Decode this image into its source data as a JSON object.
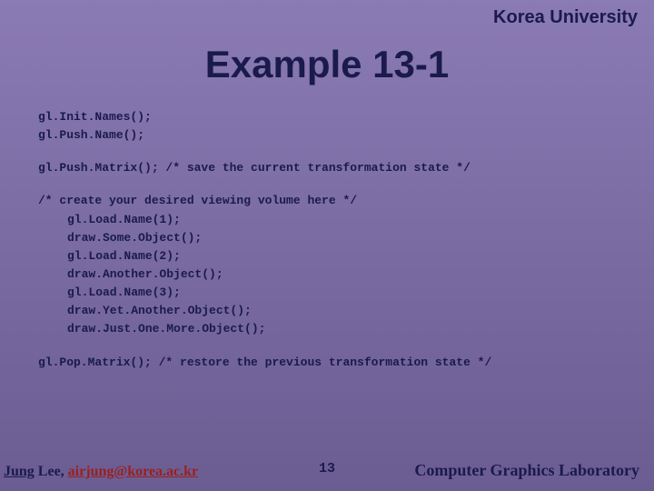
{
  "header": "Korea University",
  "title": "Example 13-1",
  "code": {
    "l1": "gl.Init.Names();",
    "l2": "gl.Push.Name();",
    "l3": "gl.Push.Matrix();  /* save the current transformation state */",
    "l4": "/* create your desired viewing volume here */",
    "l5": "gl.Load.Name(1);",
    "l6": "draw.Some.Object();",
    "l7": "gl.Load.Name(2);",
    "l8": "draw.Another.Object();",
    "l9": "gl.Load.Name(3);",
    "l10": "draw.Yet.Another.Object();",
    "l11": "draw.Just.One.More.Object();",
    "l12": "gl.Pop.Matrix();  /* restore the previous transformation state */"
  },
  "footer": {
    "author_name": "Jung",
    "author_rest": " Lee, ",
    "email": "airjung@korea.ac.kr",
    "page": "13",
    "lab": "Computer Graphics Laboratory"
  }
}
